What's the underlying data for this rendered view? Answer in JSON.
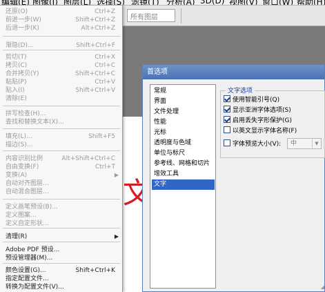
{
  "menubar": {
    "items": [
      "编辑(E)",
      "图像(I)",
      "图层(L)",
      "选择(S)",
      "滤镜(T)",
      "分析(A)",
      "3D(D)",
      "视图(V)",
      "窗口(W)",
      "帮助(H)"
    ]
  },
  "optbar": {
    "layer_select": "所有图层"
  },
  "canvas": {
    "glyph": "文"
  },
  "edit_menu": {
    "items": [
      {
        "label": "还原(O)",
        "shortcut": "Ctrl+Z",
        "enabled": false
      },
      {
        "label": "前进一步(W)",
        "shortcut": "Shift+Ctrl+Z",
        "enabled": false
      },
      {
        "label": "后退一步(K)",
        "shortcut": "Alt+Ctrl+Z",
        "enabled": false
      },
      {
        "label": "渐隐(D)...",
        "shortcut": "Shift+Ctrl+F",
        "enabled": false
      },
      {
        "label": "剪切(T)",
        "shortcut": "Ctrl+X",
        "enabled": false
      },
      {
        "label": "拷贝(C)",
        "shortcut": "Ctrl+C",
        "enabled": false
      },
      {
        "label": "合并拷贝(Y)",
        "shortcut": "Shift+Ctrl+C",
        "enabled": false
      },
      {
        "label": "粘贴(P)",
        "shortcut": "Ctrl+V",
        "enabled": false
      },
      {
        "label": "贴入(I)",
        "shortcut": "Shift+Ctrl+V",
        "enabled": false
      },
      {
        "label": "清除(E)",
        "shortcut": "",
        "enabled": false
      },
      {
        "label": "拼写检查(H)...",
        "shortcut": "",
        "enabled": false
      },
      {
        "label": "查找和替换文本(X)...",
        "shortcut": "",
        "enabled": false
      },
      {
        "label": "填充(L)...",
        "shortcut": "Shift+F5",
        "enabled": false
      },
      {
        "label": "描边(S)...",
        "shortcut": "",
        "enabled": false
      },
      {
        "label": "内容识别比例",
        "shortcut": "Alt+Shift+Ctrl+C",
        "enabled": false
      },
      {
        "label": "自由变换(F)",
        "shortcut": "Ctrl+T",
        "enabled": false
      },
      {
        "label": "变换(A)",
        "shortcut": "",
        "enabled": false,
        "submenu": true
      },
      {
        "label": "自动对齐图层...",
        "shortcut": "",
        "enabled": false
      },
      {
        "label": "自动混合图层...",
        "shortcut": "",
        "enabled": false
      },
      {
        "label": "定义画笔预设(B)...",
        "shortcut": "",
        "enabled": false
      },
      {
        "label": "定义图案...",
        "shortcut": "",
        "enabled": false
      },
      {
        "label": "定义自定形状...",
        "shortcut": "",
        "enabled": false
      },
      {
        "label": "清理(R)",
        "shortcut": "",
        "enabled": true,
        "submenu": true
      },
      {
        "label": "Adobe PDF 预设...",
        "shortcut": "",
        "enabled": true
      },
      {
        "label": "预设管理器(M)...",
        "shortcut": "",
        "enabled": true
      },
      {
        "label": "颜色设置(G)...",
        "shortcut": "Shift+Ctrl+K",
        "enabled": true
      },
      {
        "label": "指定配置文件...",
        "shortcut": "",
        "enabled": true
      },
      {
        "label": "转换为配置文件(V)...",
        "shortcut": "",
        "enabled": true
      }
    ]
  },
  "dialog": {
    "title": "首选项",
    "categories": [
      "常规",
      "界面",
      "文件处理",
      "性能",
      "光标",
      "透明度与色域",
      "单位与标尺",
      "参考线、网格和切片",
      "增效工具",
      "文字"
    ],
    "selected_category": "文字",
    "group_title": "文字选项",
    "options": [
      {
        "label": "使用智能引号(Q)",
        "checked": true
      },
      {
        "label": "显示亚洲字体选项(S)",
        "checked": true
      },
      {
        "label": "启用丢失字形保护(G)",
        "checked": true
      },
      {
        "label": "以英文显示字体名称(F)",
        "checked": false
      },
      {
        "label": "字体预览大小(V):",
        "checked": false
      }
    ],
    "preview_size_value": "中"
  }
}
